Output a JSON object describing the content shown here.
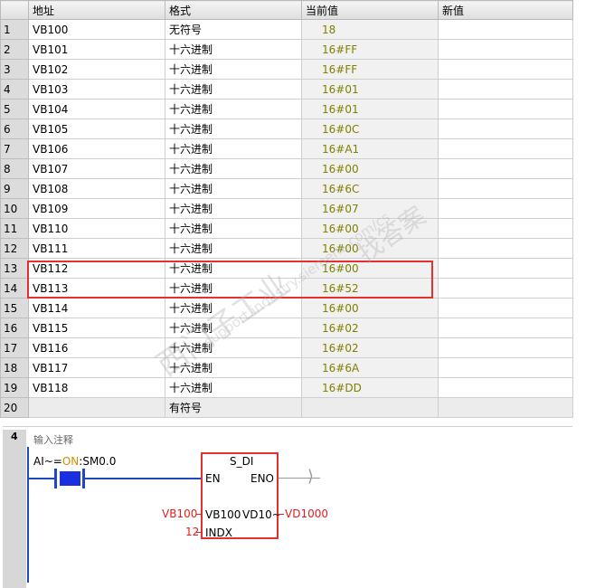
{
  "table": {
    "headers": [
      "",
      "地址",
      "格式",
      "当前值",
      "新值"
    ],
    "rows": [
      {
        "num": "1",
        "address": "VB100",
        "format": "无符号",
        "value": "18",
        "new": ""
      },
      {
        "num": "2",
        "address": "VB101",
        "format": "十六进制",
        "value": "16#FF",
        "new": ""
      },
      {
        "num": "3",
        "address": "VB102",
        "format": "十六进制",
        "value": "16#FF",
        "new": ""
      },
      {
        "num": "4",
        "address": "VB103",
        "format": "十六进制",
        "value": "16#01",
        "new": ""
      },
      {
        "num": "5",
        "address": "VB104",
        "format": "十六进制",
        "value": "16#01",
        "new": ""
      },
      {
        "num": "6",
        "address": "VB105",
        "format": "十六进制",
        "value": "16#0C",
        "new": ""
      },
      {
        "num": "7",
        "address": "VB106",
        "format": "十六进制",
        "value": "16#A1",
        "new": ""
      },
      {
        "num": "8",
        "address": "VB107",
        "format": "十六进制",
        "value": "16#00",
        "new": ""
      },
      {
        "num": "9",
        "address": "VB108",
        "format": "十六进制",
        "value": "16#6C",
        "new": ""
      },
      {
        "num": "10",
        "address": "VB109",
        "format": "十六进制",
        "value": "16#07",
        "new": ""
      },
      {
        "num": "11",
        "address": "VB110",
        "format": "十六进制",
        "value": "16#00",
        "new": ""
      },
      {
        "num": "12",
        "address": "VB111",
        "format": "十六进制",
        "value": "16#00",
        "new": ""
      },
      {
        "num": "13",
        "address": "VB112",
        "format": "十六进制",
        "value": "16#00",
        "new": ""
      },
      {
        "num": "14",
        "address": "VB113",
        "format": "十六进制",
        "value": "16#52",
        "new": ""
      },
      {
        "num": "15",
        "address": "VB114",
        "format": "十六进制",
        "value": "16#00",
        "new": ""
      },
      {
        "num": "16",
        "address": "VB115",
        "format": "十六进制",
        "value": "16#02",
        "new": ""
      },
      {
        "num": "17",
        "address": "VB116",
        "format": "十六进制",
        "value": "16#02",
        "new": ""
      },
      {
        "num": "18",
        "address": "VB117",
        "format": "十六进制",
        "value": "16#6A",
        "new": ""
      },
      {
        "num": "19",
        "address": "VB118",
        "format": "十六进制",
        "value": "16#DD",
        "new": ""
      },
      {
        "num": "20",
        "address": "",
        "format": "有符号",
        "value": "",
        "new": ""
      }
    ]
  },
  "watermark": {
    "line1": "西门子工业",
    "line2": "support.industry.siemens.com/cs",
    "line3": "找答案"
  },
  "ladder": {
    "network_number": "4",
    "comment": "输入注释",
    "contact": {
      "prefix": "AI~=",
      "state": "ON",
      "address": ":SM0.0"
    },
    "box": {
      "title": "S_DI",
      "en": "EN",
      "eno": "ENO",
      "in_param": "VB100",
      "out_param": "VD10~",
      "indx": "INDX",
      "in_value": "VB100",
      "out_value": "VD1000",
      "indx_value": "12"
    }
  },
  "colors": {
    "rail": "#1f49c2",
    "highlight": "#e53030",
    "value_text": "#808000"
  }
}
